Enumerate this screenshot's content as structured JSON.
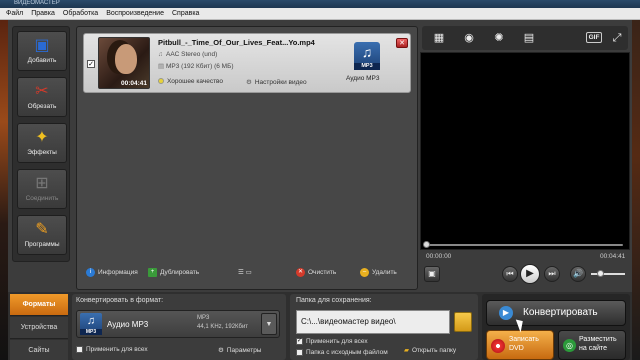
{
  "window": {
    "title": "ВИДЕОМАСТЕР"
  },
  "menu": [
    "Файл",
    "Правка",
    "Обработка",
    "Воспроизведение",
    "Справка"
  ],
  "sidebar": [
    {
      "label": "Добавить",
      "icon": "add-film-icon",
      "color": "#2a6ad4"
    },
    {
      "label": "Обрезать",
      "icon": "cut-film-icon",
      "color": "#d43a2a"
    },
    {
      "label": "Эффекты",
      "icon": "effects-icon",
      "color": "#f0c020"
    },
    {
      "label": "Соединить",
      "icon": "join-icon",
      "color": "#777777"
    },
    {
      "label": "Программы",
      "icon": "programs-icon",
      "color": "#f0a020"
    }
  ],
  "file": {
    "checked": "✓",
    "name": "Pitbull_-_Time_Of_Our_Lives_Feat...Yo.mp4",
    "duration": "00:04:41",
    "audio": "AAC Stereo (und)",
    "output": "MP3 (192 Кбит) (6 МБ)",
    "quality": "Хорошее качество",
    "video_settings": "Настройки видео",
    "format_badge": "MP3",
    "format_label": "Аудио MP3"
  },
  "file_toolbar": {
    "info": "Информация",
    "duplicate": "Дублировать",
    "clear": "Очистить",
    "delete": "Удалить"
  },
  "preview": {
    "time_start": "00:00:00",
    "time_end": "00:04:41",
    "gif_label": "GIF",
    "position": 0.0,
    "volume": 0.2
  },
  "tabs": [
    "Форматы",
    "Устройства",
    "Сайты"
  ],
  "format_panel": {
    "header": "Конвертировать в формат:",
    "badge": "MP3",
    "name": "Аудио MP3",
    "spec1": "MP3",
    "spec2": "44,1 KHz, 192Кбит",
    "apply_all": "Применить для всех",
    "params": "Параметры"
  },
  "save_panel": {
    "header": "Папка для сохранения:",
    "path": "C:\\...\\видеомастер видео\\",
    "apply_all": "Применить для всех",
    "source_folder": "Папка с исходным файлом",
    "open_folder": "Открыть папку"
  },
  "actions": {
    "convert": "Конвертировать",
    "burn_line1": "Записать",
    "burn_line2": "DVD",
    "share_line1": "Разместить",
    "share_line2": "на сайте"
  }
}
